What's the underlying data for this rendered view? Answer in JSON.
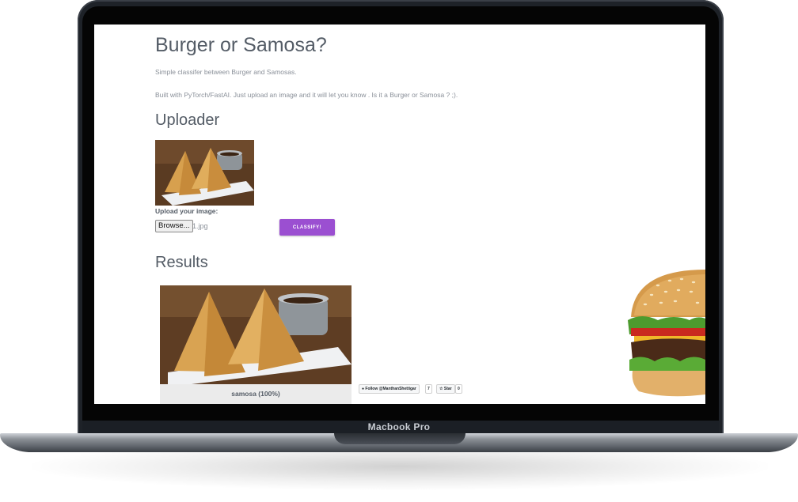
{
  "device": {
    "label": "Macbook Pro"
  },
  "page": {
    "title": "Burger or Samosa?",
    "description": "Simple classifer between Burger and Samosas.",
    "built_with": "Built with PyTorch/FastAI. Just upload an image and it will let you know . Is it a Burger or Samosa ? ;)."
  },
  "uploader": {
    "heading": "Uploader",
    "label": "Upload your image:",
    "browse_label": "Browse...",
    "file_name": "1.jpg",
    "classify_label": "CLASSIFY!",
    "accent_color": "#9b4fd1"
  },
  "results": {
    "heading": "Results",
    "prediction": "samosa (100%)"
  },
  "github": {
    "follow_label": "Follow @ManthanShettigar",
    "follow_count": "7",
    "star_label": "Star",
    "star_count": "0"
  }
}
